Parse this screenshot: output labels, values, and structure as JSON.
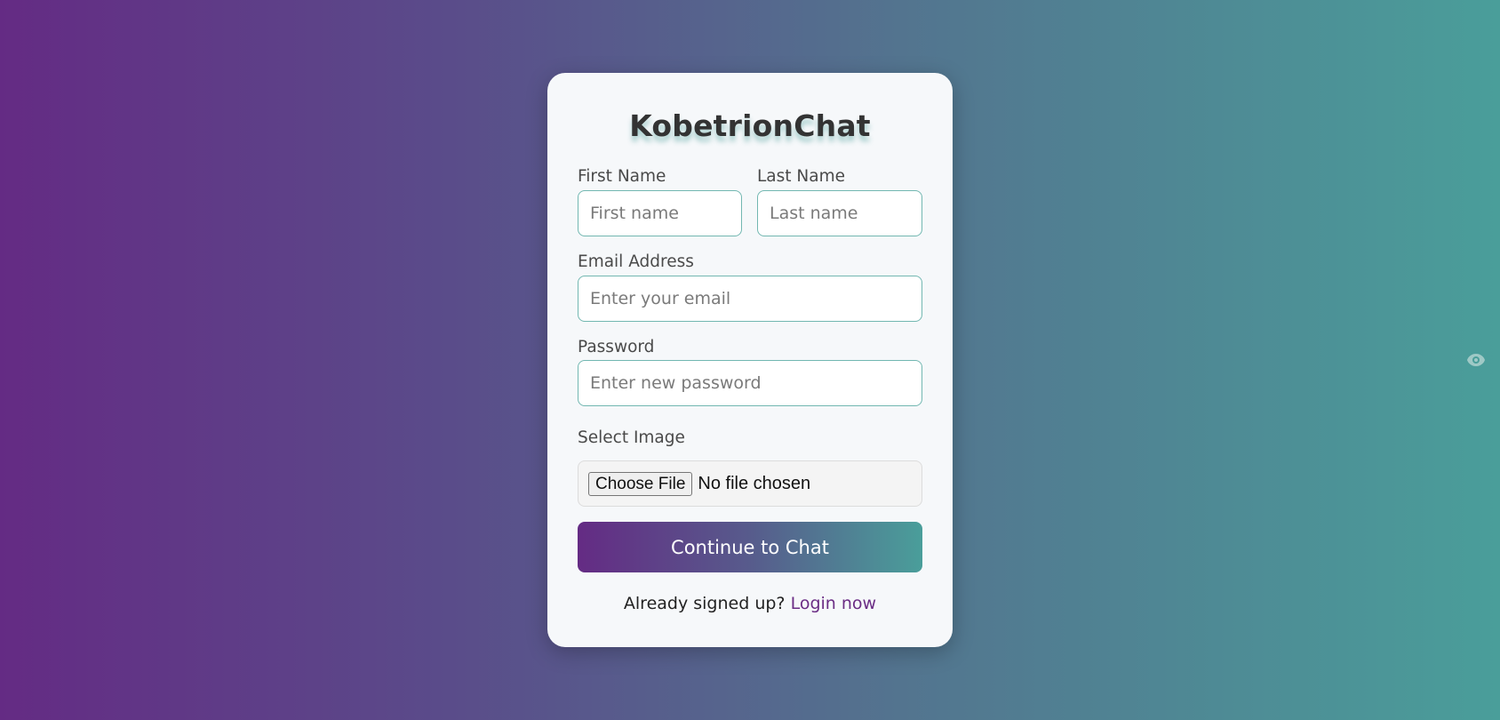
{
  "app": {
    "title": "KobetrionChat"
  },
  "form": {
    "first_name": {
      "label": "First Name",
      "placeholder": "First name",
      "value": ""
    },
    "last_name": {
      "label": "Last Name",
      "placeholder": "Last name",
      "value": ""
    },
    "email": {
      "label": "Email Address",
      "placeholder": "Enter your email",
      "value": ""
    },
    "password": {
      "label": "Password",
      "placeholder": "Enter new password",
      "value": ""
    },
    "image": {
      "label": "Select Image",
      "button_label": "Choose File",
      "status": "No file chosen"
    },
    "submit_label": "Continue to Chat"
  },
  "footer": {
    "text": "Already signed up?",
    "link_label": "Login now"
  },
  "icons": {
    "password_toggle": "eye-icon"
  },
  "colors": {
    "gradient_start": "#642b84",
    "gradient_end": "#4a9e9a",
    "input_border": "#72b7b1",
    "link": "#6b2d85",
    "card_bg": "#f6f8fa"
  }
}
